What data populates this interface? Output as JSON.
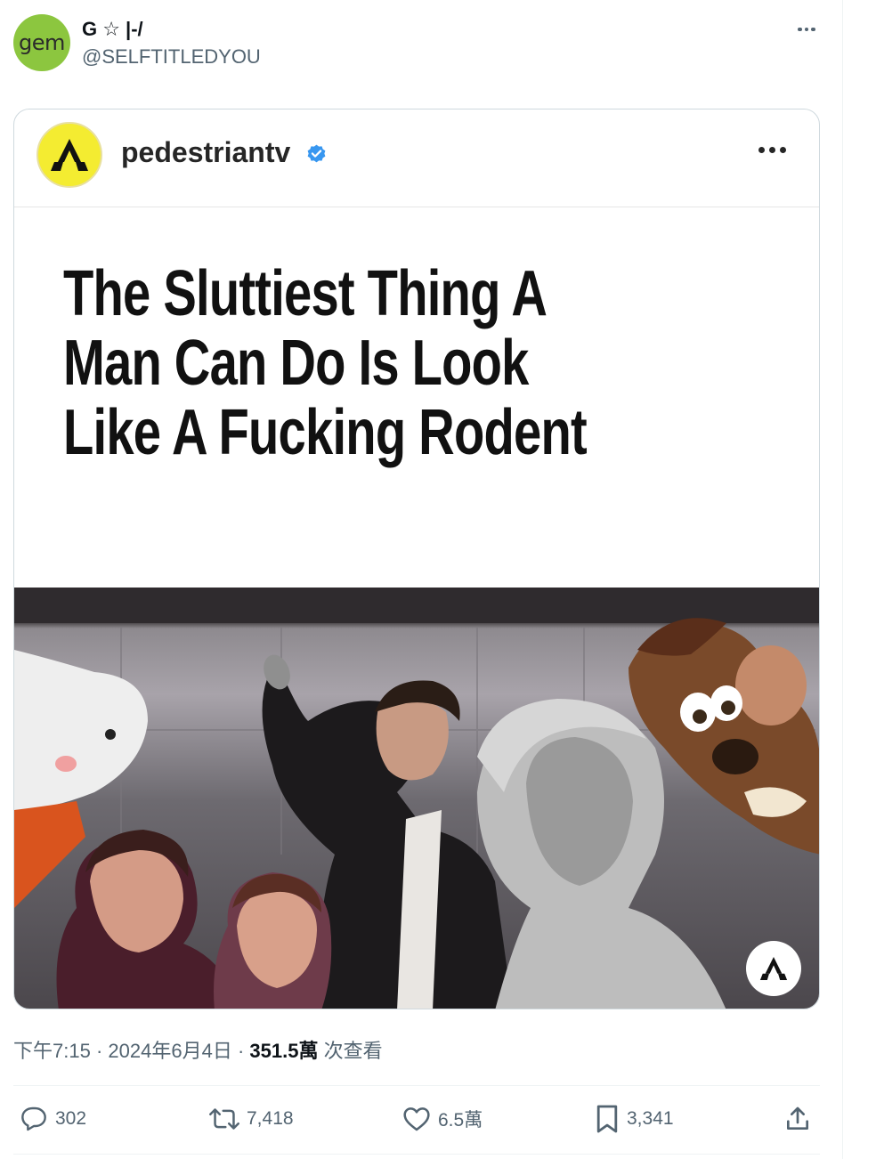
{
  "tweet": {
    "avatar_text": "gem",
    "display_name": "G ☆ |-/",
    "handle": "@SELFTITLEDYOU"
  },
  "embed": {
    "account_name": "pedestriantv",
    "headline": "The Sluttiest Thing A Man Can Do Is Look Like A Fucking Rodent"
  },
  "meta": {
    "time": "下午7:15",
    "date": "2024年6月4日",
    "views_count": "351.5萬",
    "views_label": "次查看"
  },
  "actions": {
    "replies": "302",
    "reposts": "7,418",
    "likes": "6.5萬",
    "bookmarks": "3,341"
  },
  "colors": {
    "verified": "#3897f0",
    "avatar_bg": "#8cc63f",
    "brand_yellow": "#f4ec31"
  }
}
